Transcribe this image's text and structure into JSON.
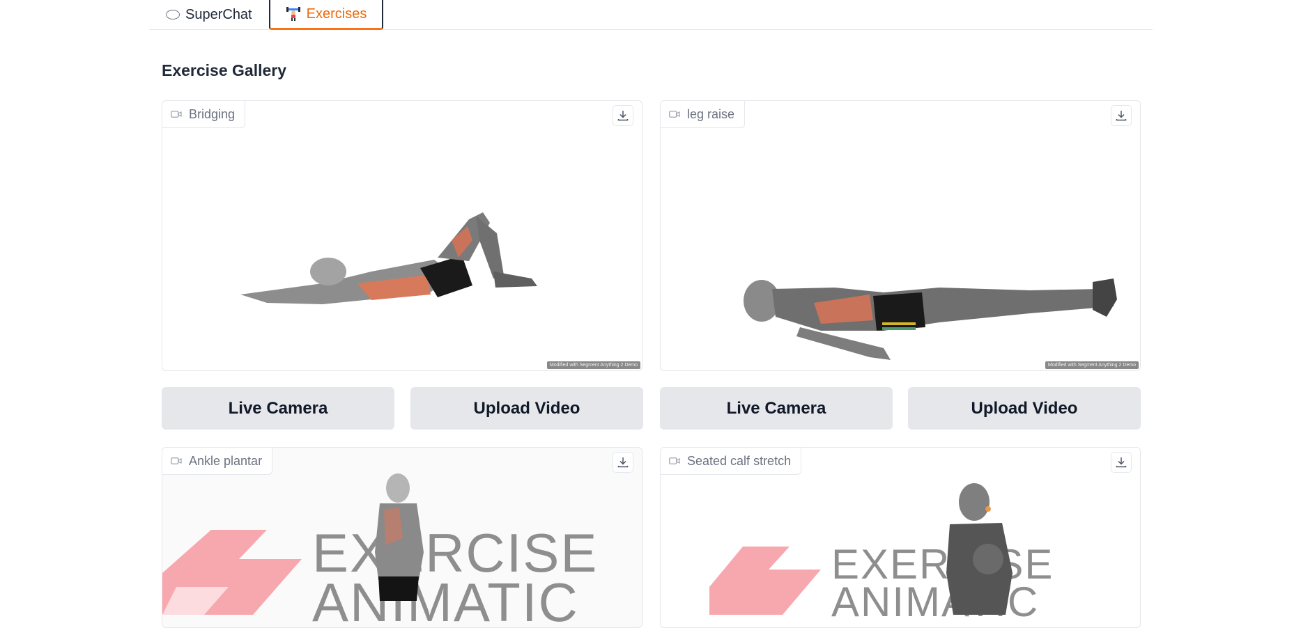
{
  "tabs": [
    {
      "label": "SuperChat",
      "icon": "speech-bubble-icon",
      "active": false
    },
    {
      "label": "Exercises",
      "icon": "weightlifter-icon",
      "active": true
    }
  ],
  "section": {
    "title": "Exercise Gallery"
  },
  "videos": [
    {
      "label": "Bridging",
      "watermark": "Modified with Segment Anything 2 Demo"
    },
    {
      "label": "leg raise",
      "watermark": "Modified with Segment Anything 2 Demo"
    },
    {
      "label": "Ankle plantar",
      "logo_line1": "EXERCISE",
      "logo_line2": "ANIMATIC"
    },
    {
      "label": "Seated calf stretch",
      "logo_line1": "EXERCISE",
      "logo_line2": "ANIMATIC"
    }
  ],
  "buttons": {
    "live_camera": "Live Camera",
    "upload_video": "Upload Video"
  },
  "colors": {
    "accent": "#f97316",
    "button_bg": "#e5e7eb",
    "logo_pink": "#f7a8ae",
    "logo_gray": "#8e8e8e"
  }
}
